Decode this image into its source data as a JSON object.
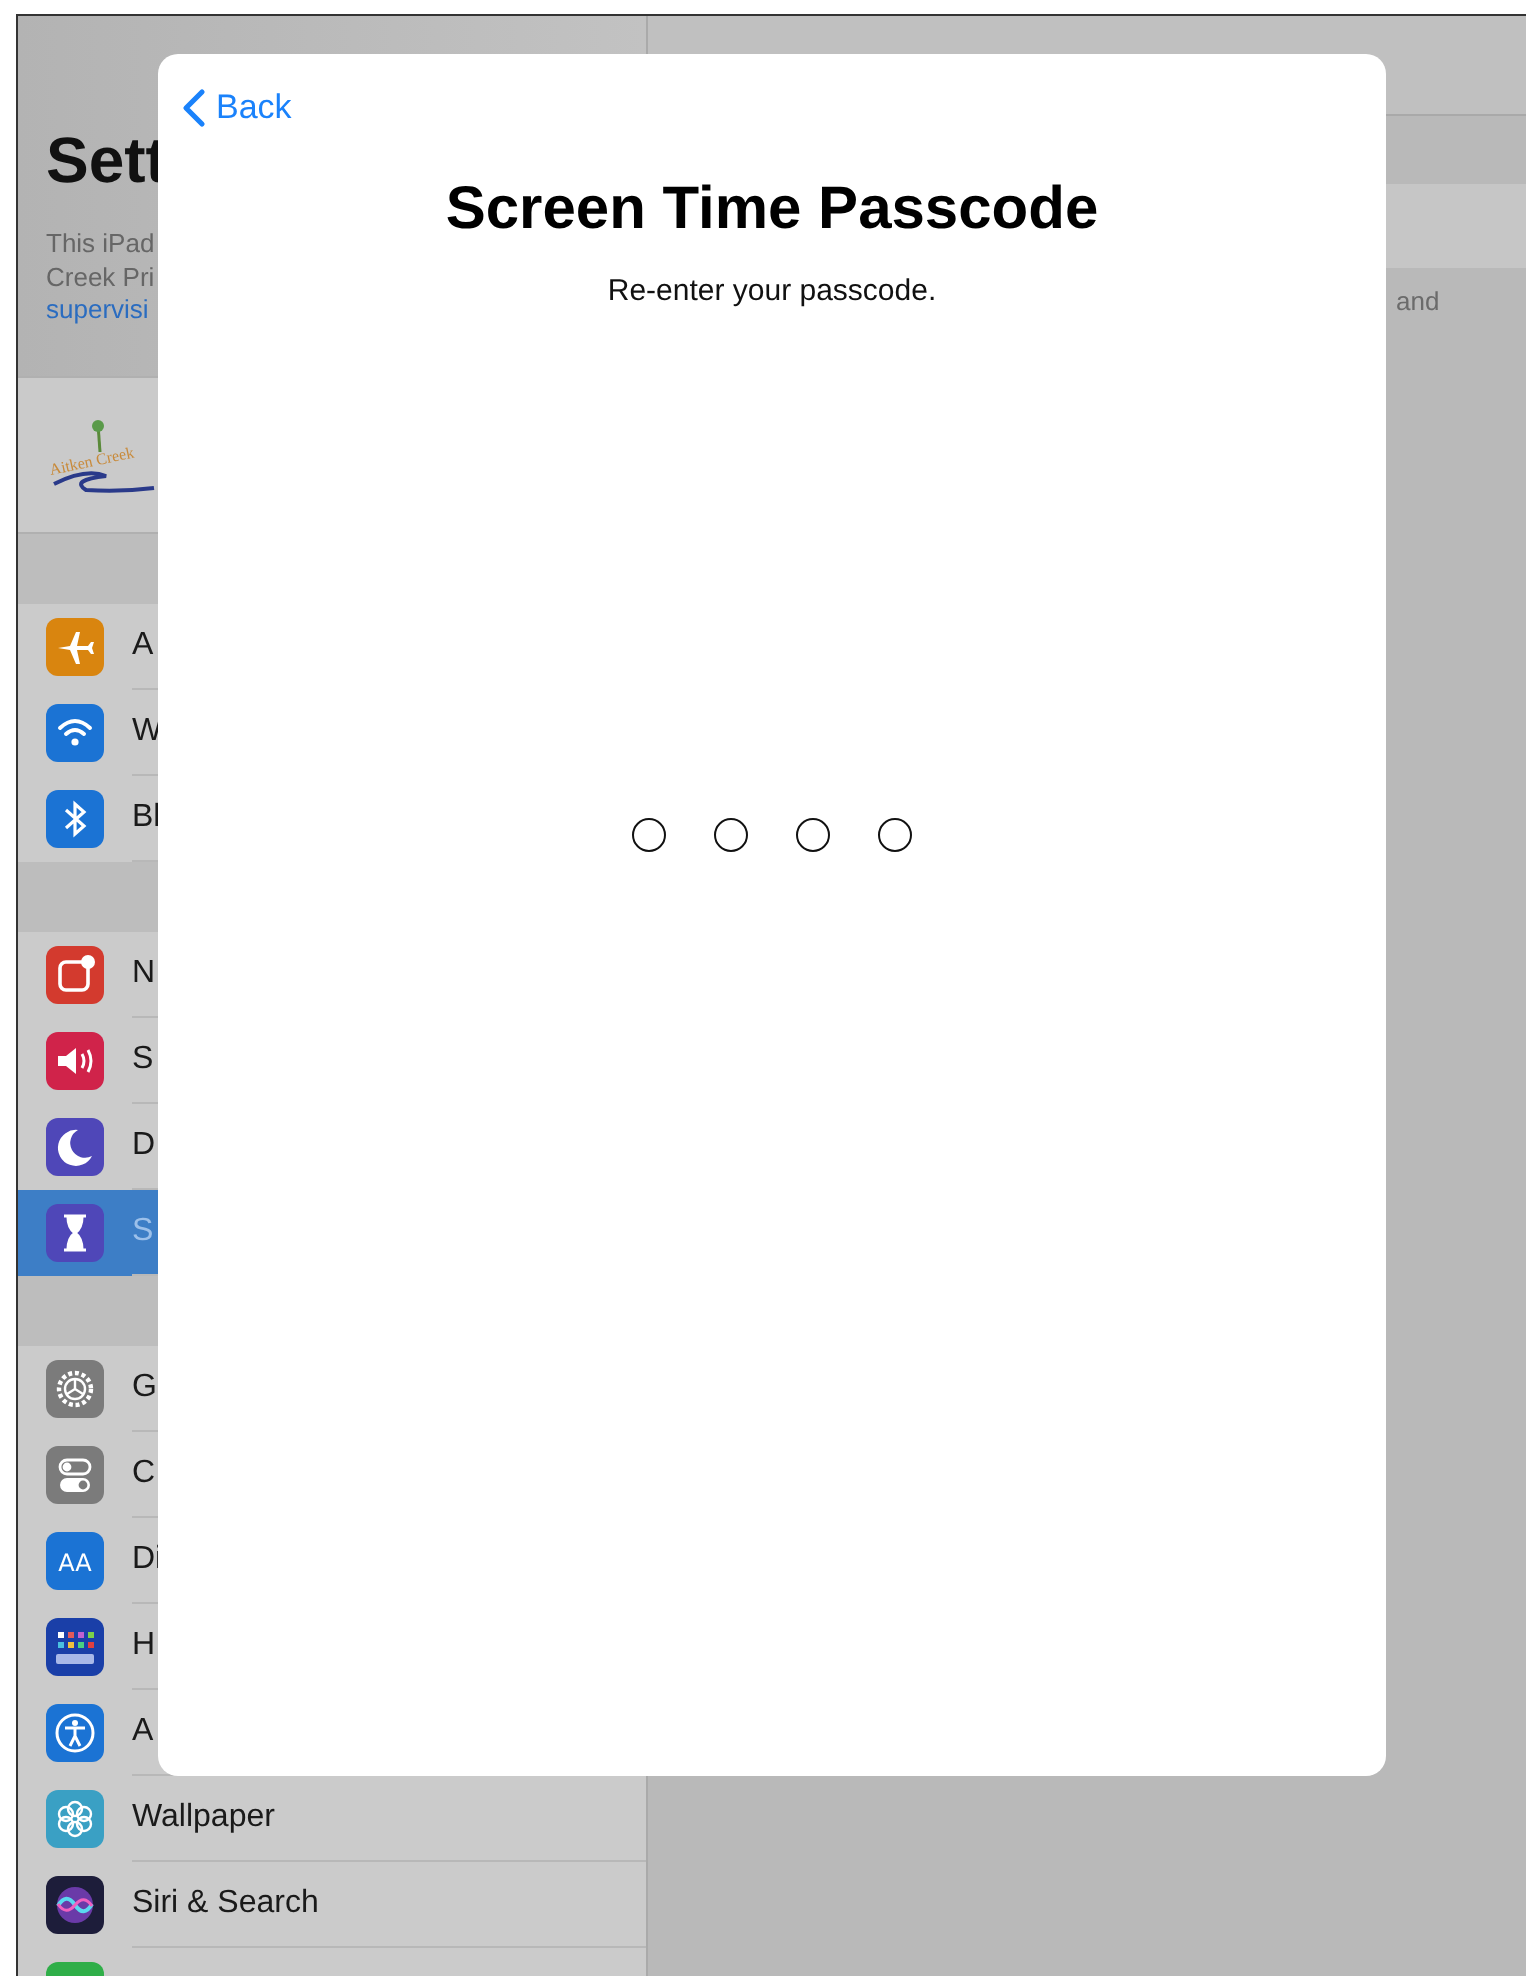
{
  "sidebar": {
    "title": "Sett",
    "description": [
      "This iPad",
      "Creek Pri"
    ],
    "link": "supervisi",
    "logo_text": "Aitken Creek",
    "groups": [
      [
        {
          "kind": "airplane",
          "color": "#d9850f",
          "label": "A",
          "selected": false
        },
        {
          "kind": "wifi",
          "color": "#1b73d4",
          "label": "W",
          "selected": false
        },
        {
          "kind": "bluetooth",
          "color": "#1b73d4",
          "label": "Bl",
          "selected": false
        }
      ],
      [
        {
          "kind": "notifications",
          "color": "#d33a2e",
          "label": "N",
          "selected": false
        },
        {
          "kind": "speaker",
          "color": "#d0234a",
          "label": "S",
          "selected": false
        },
        {
          "kind": "moon",
          "color": "#4f47b8",
          "label": "D",
          "selected": false
        },
        {
          "kind": "hourglass",
          "color": "#4f47b8",
          "label": "S",
          "selected": true
        }
      ],
      [
        {
          "kind": "gear",
          "color": "#7b7b7b",
          "label": "G",
          "selected": false
        },
        {
          "kind": "toggles",
          "color": "#7b7b7b",
          "label": "C",
          "selected": false
        },
        {
          "kind": "glyph",
          "glyph": "AA",
          "color": "#1b73d4",
          "label": "Di",
          "selected": false
        },
        {
          "kind": "grid",
          "color": "#1a3fa8",
          "label": "H",
          "selected": false
        },
        {
          "kind": "accessibility",
          "color": "#1b73d4",
          "label": "A",
          "selected": false
        },
        {
          "kind": "flower",
          "color": "#3aa0c4",
          "label": "Wallpaper",
          "selected": false
        },
        {
          "kind": "siri",
          "color": "#1d1d3a",
          "label": "Siri & Search",
          "selected": false
        },
        {
          "kind": "blank",
          "color": "#2fae48",
          "selected": false
        }
      ]
    ]
  },
  "detail": {
    "footer_text": "and"
  },
  "sheet": {
    "back": "Back",
    "title": "Screen Time Passcode",
    "subtitle": "Re-enter your passcode.",
    "passcode_dots": [
      {
        "filled": false
      },
      {
        "filled": false
      },
      {
        "filled": false
      },
      {
        "filled": false
      }
    ]
  }
}
